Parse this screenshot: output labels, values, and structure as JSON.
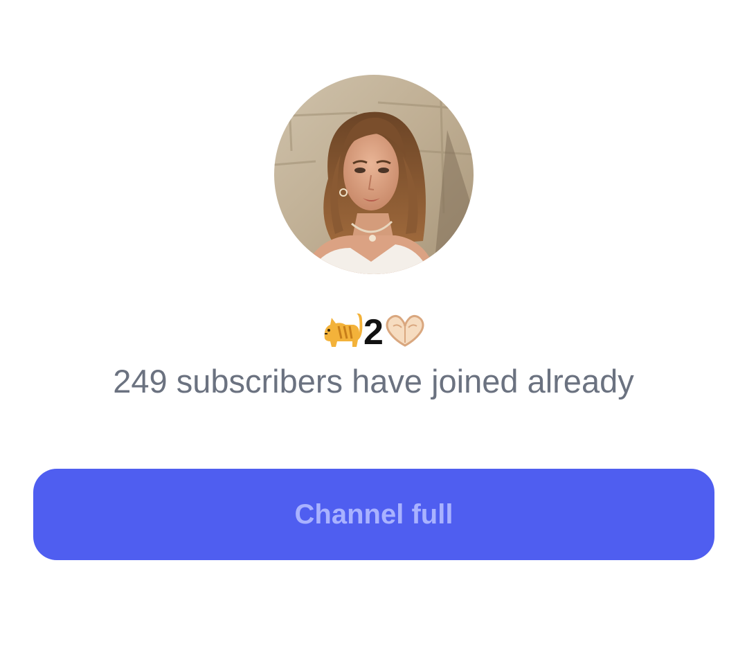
{
  "channel": {
    "avatar_alt": "channel avatar",
    "name_prefix_icon": "cat-emoji",
    "name_number": "2",
    "name_suffix_icon": "heart-hands-emoji",
    "subscribers_text": "249 subscribers have joined already"
  },
  "action": {
    "button_label": "Channel full",
    "button_state": "disabled"
  },
  "colors": {
    "button_bg": "#4f5ef0",
    "button_text": "#a9b2ff",
    "muted_text": "#6b7280",
    "page_bg": "#ffffff"
  }
}
